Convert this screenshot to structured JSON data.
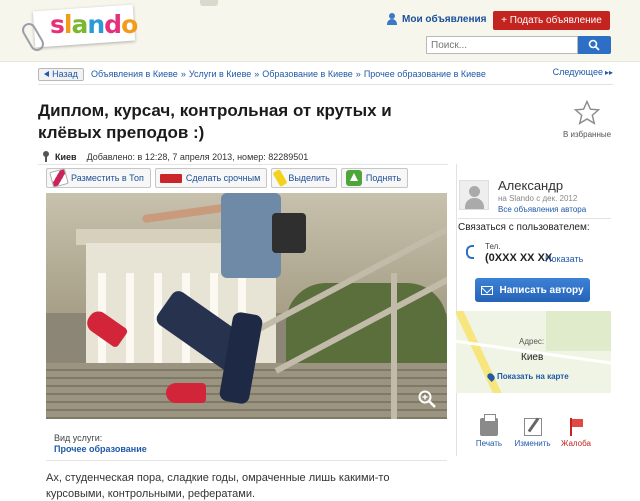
{
  "header": {
    "logo_text": "slando",
    "my_ads_label": "Мои объявления",
    "post_ad_label": "+ Подать объявление",
    "search_placeholder": "Поиск..."
  },
  "breadcrumbs": {
    "back_label": "Назад",
    "items": [
      "Объявления в Киеве",
      "Услуги в Киеве",
      "Образование в Киеве",
      "Прочее образование в Киеве"
    ],
    "separator": "»",
    "next_label": "Следующее"
  },
  "ad": {
    "title": "Диплом, курсач, контрольная от крутых и клёвых преподов :)",
    "city": "Киев",
    "added_info": "Добавлено: в 12:28, 7 апреля 2013, номер: 82289501",
    "favorite_label": "В избранные",
    "actions": [
      {
        "label": "Разместить в Топ",
        "icon": "pen-icon"
      },
      {
        "label": "Сделать срочным",
        "icon": "urgent-icon"
      },
      {
        "label": "Выделить",
        "icon": "marker-icon"
      },
      {
        "label": "Поднять",
        "icon": "up-arrow-icon"
      }
    ],
    "service_type_label": "Вид услуги:",
    "service_type_value": "Прочее образование",
    "description": "Ах, студенческая пора, сладкие годы, омраченные лишь какими-то курсовыми, контрольными, рефератами."
  },
  "seller": {
    "name": "Александр",
    "since": "на Slando с дек. 2012",
    "all_ads_link": "Все объявления автора",
    "contact_title": "Связаться с пользователем:",
    "tel_label": "Тел.",
    "tel_number": "(0XXX XX XX",
    "tel_show": "Показать",
    "write_button": "Написать автору",
    "address_label": "Адрес:",
    "address_city": "Киев",
    "show_on_map": "Показать на карте"
  },
  "tools": {
    "print": "Печать",
    "edit": "Изменить",
    "complain": "Жалоба"
  },
  "colors": {
    "accent_red": "#c3241f",
    "link_blue": "#1f59a8",
    "button_blue": "#2d6fc4"
  }
}
